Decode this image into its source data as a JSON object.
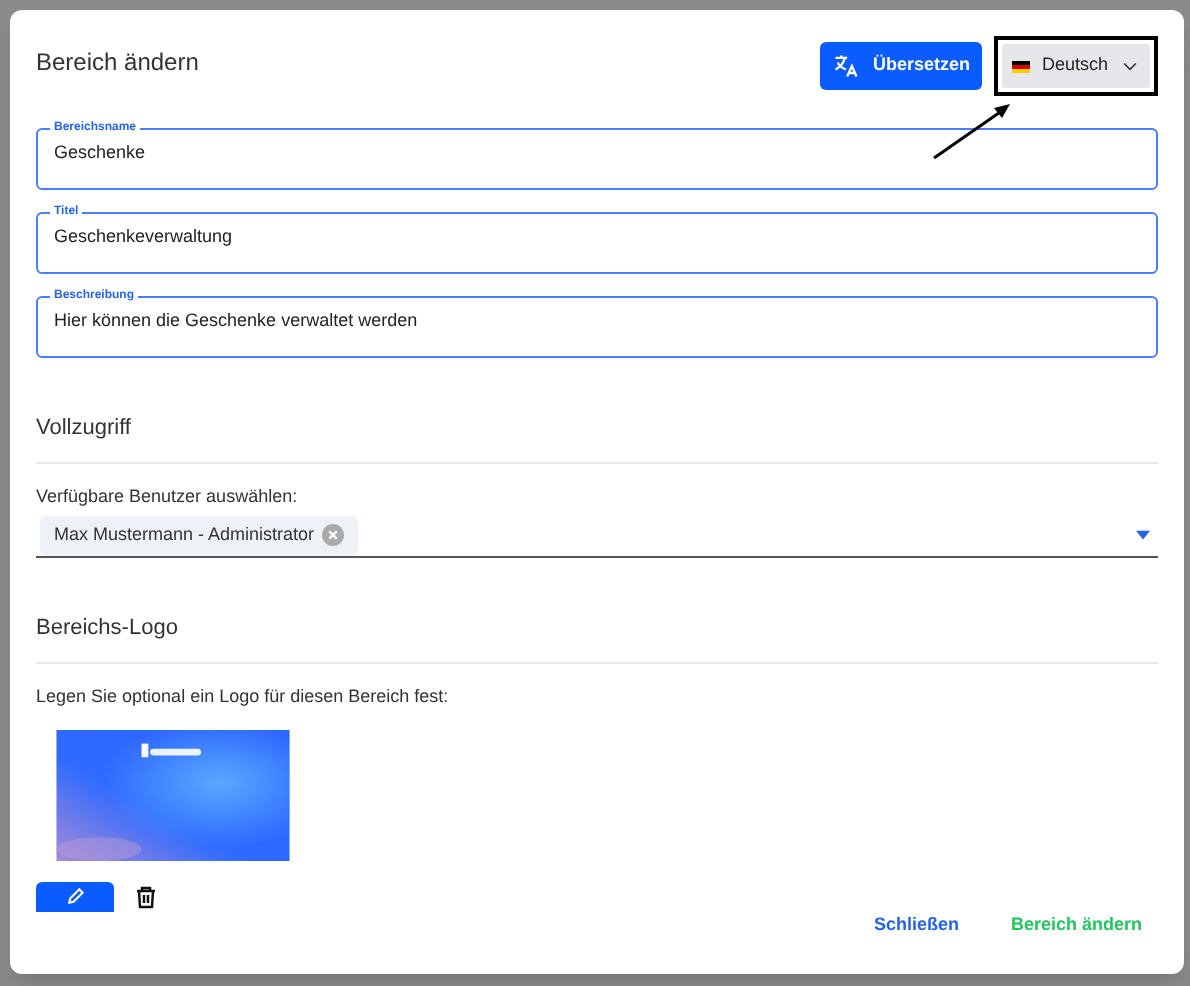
{
  "dialog": {
    "title": "Bereich ändern",
    "translate_button": "Übersetzen",
    "language_select": {
      "value": "Deutsch",
      "highlighted": true
    },
    "fields": [
      {
        "label": "Bereichsname",
        "value": "Geschenke"
      },
      {
        "label": "Titel",
        "value": "Geschenkeverwaltung"
      },
      {
        "label": "Beschreibung",
        "value": "Hier können die Geschenke verwaltet werden"
      }
    ],
    "access": {
      "heading": "Vollzugriff",
      "label": "Verfügbare Benutzer auswählen:",
      "chips": [
        "Max Mustermann - Administrator"
      ]
    },
    "logo": {
      "heading": "Bereichs-Logo",
      "hint": "Legen Sie optional ein Logo für diesen Bereich fest:"
    },
    "footer": {
      "buttons": [
        {
          "label": "Schließen",
          "kind": "secondary"
        },
        {
          "label": "Bereich ändern",
          "kind": "primary"
        }
      ]
    }
  }
}
